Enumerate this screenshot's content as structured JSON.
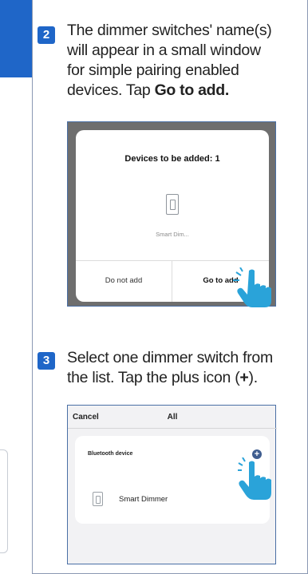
{
  "steps": [
    {
      "number": "2",
      "text_before": "The dimmer switches' name(s) will appear in a small window for simple pairing enabled devices. Tap ",
      "bold": "Go to add."
    },
    {
      "number": "3",
      "text_before": "Select one dimmer switch from the list. Tap the plus icon (",
      "bold": "+",
      "text_after": ")."
    }
  ],
  "screen1": {
    "title": "Devices to be added: 1",
    "device_name": "Smart Dim...",
    "device_icon": "switch-icon",
    "cancel_label": "Do not add",
    "confirm_label": "Go to add",
    "pointer_icon": "hand-pointer-icon"
  },
  "screen2": {
    "cancel_label": "Cancel",
    "title": "All",
    "section_label": "Bluetooth device",
    "add_icon": "plus-circle-icon",
    "add_symbol": "+",
    "device_icon": "switch-icon",
    "device_name": "Smart Dimmer",
    "pointer_icon": "hand-pointer-icon"
  },
  "colors": {
    "accent": "#1f66c8",
    "frame_border": "#4a6fa5",
    "hand": "#2aa3d9"
  }
}
